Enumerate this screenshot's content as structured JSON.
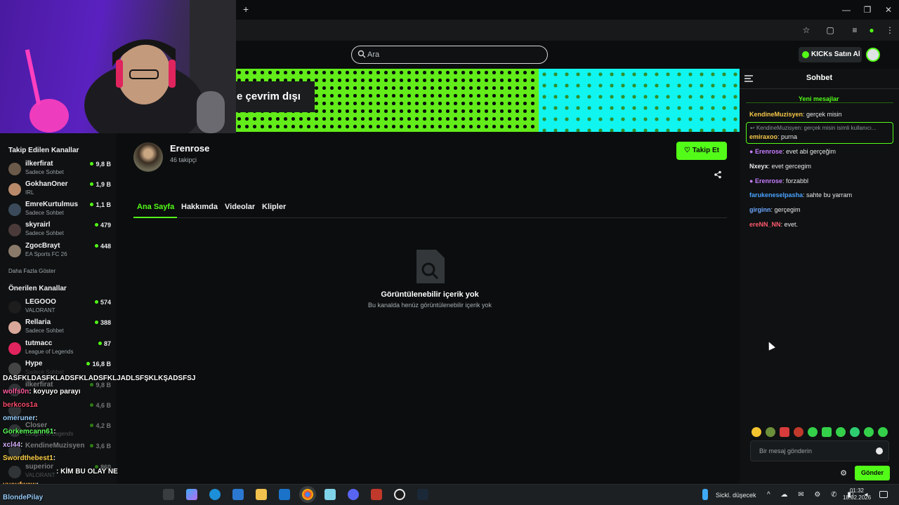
{
  "browser": {
    "new_tab_label": "+",
    "window_controls": [
      "minimize-icon",
      "restore-icon",
      "close-icon"
    ],
    "toolbar_icons": [
      "star-icon",
      "extensions-icon",
      "media-icon",
      "profile-icon",
      "menu-icon"
    ]
  },
  "header": {
    "search_placeholder": "Ara",
    "kicks_button": "KICKs Satın Al"
  },
  "banner": {
    "offline_text": "e çevrim dışı"
  },
  "sidebar": {
    "followed_title": "Takip Edilen Kanallar",
    "followed": [
      {
        "name": "ilkerfirat",
        "sub": "Sadece Sohbet",
        "viewers": "9,8 B"
      },
      {
        "name": "GokhanOner",
        "sub": "IRL",
        "viewers": "1,9 B"
      },
      {
        "name": "EmreKurtulmus",
        "sub": "Sadece Sohbet",
        "viewers": "1,1 B"
      },
      {
        "name": "skyrairl",
        "sub": "Sadece Sohbet",
        "viewers": "479"
      },
      {
        "name": "ZgocBrayt",
        "sub": "EA Sports FC 26",
        "viewers": "448"
      }
    ],
    "show_more": "Daha Fazla Göster",
    "recommended_title": "Önerilen Kanallar",
    "recommended": [
      {
        "name": "LEGOOO",
        "sub": "VALORANT",
        "viewers": "574"
      },
      {
        "name": "Rellaria",
        "sub": "Sadece Sohbet",
        "viewers": "388"
      },
      {
        "name": "tutmacc",
        "sub": "League of Legends",
        "viewers": "87"
      },
      {
        "name": "Hype",
        "sub": "Sadece Sohbet",
        "viewers": "16,8 B"
      },
      {
        "name": "ilkerfirat",
        "sub": "",
        "viewers": "9,8 B"
      },
      {
        "name": "",
        "sub": "",
        "viewers": "4,6 B"
      },
      {
        "name": "Closer",
        "sub": "League of Legends",
        "viewers": "4,2 B"
      },
      {
        "name": "KendineMuzisyen",
        "sub": "",
        "viewers": "3,6 B"
      },
      {
        "name": "superior",
        "sub": "VALORANT",
        "viewers": "860"
      }
    ]
  },
  "channel": {
    "name": "Erenrose",
    "followers": "46 takipçi",
    "follow_button": "Takip Et",
    "tabs": [
      "Ana Sayfa",
      "Hakkımda",
      "Videolar",
      "Klipler"
    ],
    "empty_title": "Görüntülenebilir içerik yok",
    "empty_subtitle": "Bu kanalda henüz görüntülenebilir içerik yok"
  },
  "chat": {
    "title": "Sohbet",
    "new_messages": "Yeni mesajlar",
    "reply_quote": "KendineMuzisyen: gerçek misin isimli kullanıcı...",
    "messages": [
      {
        "user": "KendineMuzisyen",
        "text": ": gerçek misin",
        "color": "#f6c84a",
        "icon": false
      },
      {
        "user": "emiraxoo",
        "text": ": purna",
        "color": "#f6c84a",
        "icon": false
      },
      {
        "user": "Erenrose",
        "text": ": evet abi gerçeğim",
        "color": "#c77dff",
        "icon": true
      },
      {
        "user": "Nxeyx",
        "text": ": evet gercegim",
        "color": "#e6e8e9",
        "icon": false
      },
      {
        "user": "Erenrose",
        "text": ": forzabbl",
        "color": "#c77dff",
        "icon": true
      },
      {
        "user": "farukeneselpasha",
        "text": ": sahte bu yarram",
        "color": "#4aa3ff",
        "icon": false
      },
      {
        "user": "girginn",
        "text": ": gerçegim",
        "color": "#6ea8ff",
        "icon": false
      },
      {
        "user": "ereNN_NN",
        "text": ": evet.",
        "color": "#ff5a6e",
        "icon": false
      }
    ],
    "input_placeholder": "Bir mesaj gönderin",
    "send_button": "Gönder",
    "emote_colors": [
      "#f4c430",
      "#6c8f3a",
      "#d83b3b",
      "#c0392b",
      "#35d04a",
      "#35d04a",
      "#35d04a",
      "#2ecc71",
      "#35d04a",
      "#35d04a",
      "#35d04a"
    ]
  },
  "overlay_chat": [
    {
      "user": "",
      "text": "DASFKLDASFKLADSFKLADSFKLJADLSFŞKLKŞADSFSJ",
      "color": "#ffffff"
    },
    {
      "user": "wolfs0n",
      "text": ": koyuyo parayı",
      "color": "#ff5fa2"
    },
    {
      "user": "berkcos1a",
      "text": "",
      "color": "#ff4d6d"
    },
    {
      "user": "omeruner",
      "text": ":",
      "color": "#9ad0ff"
    },
    {
      "user": "Gorkemcann61",
      "text": ":",
      "color": "#5cff5c"
    },
    {
      "user": "xcl44",
      "text": ":",
      "color": "#d9b3ff"
    },
    {
      "user": "Swordthebest1",
      "text": ":",
      "color": "#ffd24d"
    },
    {
      "user": "",
      "text": ": KİM BU OLAY NE",
      "color": "#ffffff"
    },
    {
      "user": "yusufwsw",
      "text": ":",
      "color": "#ffb24d"
    },
    {
      "user": "BlondePilay",
      "text": "",
      "color": "#9ad0ff"
    }
  ],
  "taskbar": {
    "weather": "Sickl. düşecek",
    "time": "01:32",
    "date": "18.02.2026",
    "apps": [
      "start-icon",
      "taskview-icon",
      "copilot-icon",
      "edge-icon",
      "store-icon",
      "files-icon",
      "outlook-icon",
      "chrome-icon",
      "notes-icon",
      "discord-icon",
      "app-icon",
      "obs-icon",
      "steam-icon"
    ]
  }
}
